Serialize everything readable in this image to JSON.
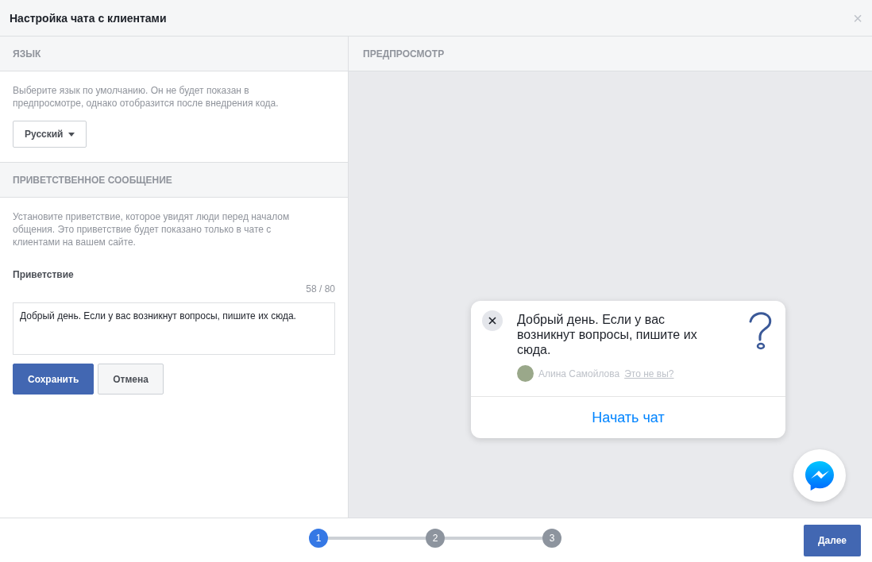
{
  "window": {
    "title": "Настройка чата с клиентами",
    "close": "×"
  },
  "language": {
    "heading": "ЯЗЫК",
    "description": "Выберите язык по умолчанию. Он не будет показан в предпросмотре, однако отобразится после внедрения кода.",
    "dropdown": "Русский"
  },
  "greeting": {
    "heading": "ПРИВЕТСТВЕННОЕ СООБЩЕНИЕ",
    "description": "Установите приветствие, которое увидят люди перед началом общения. Это приветствие будет показано только в чате с клиентами на вашем сайте.",
    "label": "Приветствие",
    "counter": "58 / 80",
    "value": "Добрый день. Если у вас возникнут вопросы, пишите их сюда.",
    "buttons": [
      "Сохранить",
      "Отмена"
    ]
  },
  "preview": {
    "heading": "ПРЕДПРОСМОТР",
    "message": "Добрый день. Если у вас возникнут вопросы, пишите их сюда.",
    "user": "Алина Самойлова",
    "not_you": "Это не вы?",
    "start_chat": "Начать чат"
  },
  "steps": [
    {
      "label": "1",
      "selected": true
    },
    {
      "label": "2",
      "selected": false
    },
    {
      "label": "3",
      "selected": false
    }
  ],
  "next_button": "Далее"
}
